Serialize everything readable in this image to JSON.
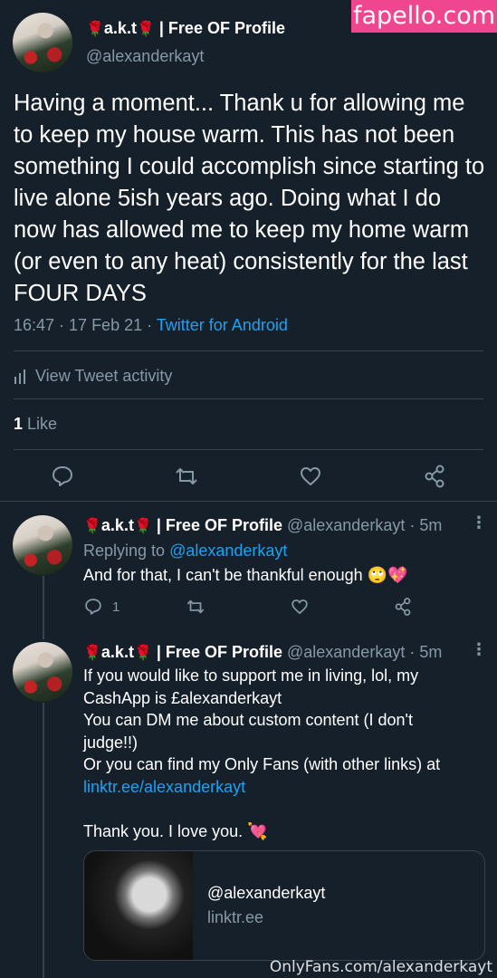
{
  "watermark": {
    "top": "fapello.com",
    "bottom": "OnlyFans.com/alexanderkayt"
  },
  "main_tweet": {
    "rose_emoji": "🌹",
    "display_name_part1": "a.k.t",
    "display_name_part2": "| Free OF Profile",
    "handle": "@alexanderkayt",
    "text": "Having a moment... Thank u for allowing me to keep my house warm. This has not been something I could accomplish since starting to live alone 5ish years ago. Doing what I do now has allowed me to keep my home warm (or even to any heat) consistently for the last FOUR DAYS",
    "timestamp": "16:47 · 17 Feb 21 · ",
    "source": "Twitter for Android",
    "activity_label": "View Tweet activity",
    "like_count": "1",
    "like_label": " Like"
  },
  "reply1": {
    "display_name_part1": "a.k.t",
    "display_name_part2": "| Free OF Profile",
    "handle_time": "@alexanderkayt · 5m",
    "replying_prefix": "Replying to ",
    "replying_handle": "@alexanderkayt",
    "text": "And for that, I can't be thankful enough 🙄💖",
    "reply_count": "1"
  },
  "reply2": {
    "display_name_part1": "a.k.t",
    "display_name_part2": "| Free OF Profile",
    "handle_time": "@alexanderkayt · 5m",
    "line1": "If you would like to support me in living, lol, my",
    "line2": "CashApp is £alexanderkayt",
    "line3": "You can DM me about custom content (I don't",
    "line4": "judge!!)",
    "line5": "Or you can find my Only Fans (with other links) at",
    "link": "linktr.ee/alexanderkayt",
    "line7": "Thank you. I love you. 💘",
    "card_title": "@alexanderkayt",
    "card_domain": "linktr.ee"
  },
  "colors": {
    "background": "#15202b",
    "accent": "#1da1f2",
    "muted": "#8899a6",
    "watermark": "#f0458f"
  },
  "icons": [
    "reply-icon",
    "retweet-icon",
    "like-icon",
    "share-icon",
    "bar-chart-icon",
    "more-icon"
  ]
}
